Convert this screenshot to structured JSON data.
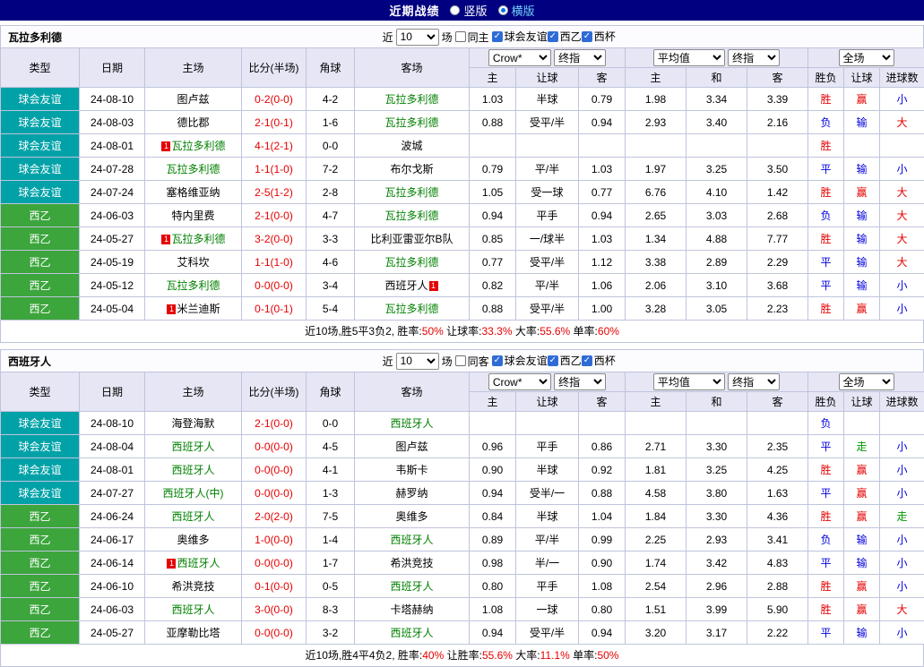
{
  "topbar": {
    "title": "近期战绩",
    "radios": [
      {
        "label": "竖版",
        "selected": false
      },
      {
        "label": "横版",
        "selected": true
      }
    ]
  },
  "controls_text": {
    "near": "近",
    "count": "10",
    "games": "场"
  },
  "header_cols": [
    "类型",
    "日期",
    "主场",
    "比分(半场)",
    "角球",
    "客场"
  ],
  "odds_subcols": [
    "主",
    "让球",
    "客",
    "主",
    "和",
    "客",
    "胜负",
    "让球",
    "进球数"
  ],
  "dropdowns": {
    "book": "Crow*",
    "final1": "终指",
    "avg": "平均值",
    "final2": "终指",
    "scope": "全场"
  },
  "colors": {
    "topbar_bg": "#000080",
    "header_bg": "#e6e6f5",
    "friendly_bg": "#00a2a8",
    "league2_bg": "#3ca53c",
    "focus_team": "#008000",
    "score_red": "#e60000",
    "result_red": "#e60000",
    "result_blue": "#0000dd",
    "result_green": "#009900"
  },
  "league_colors": {
    "球会友谊": "#00a2a8",
    "西乙": "#3ca53c",
    "西杯": "#3ca53c"
  },
  "result_colors": {
    "胜": "r",
    "平": "b",
    "负": "b",
    "赢": "r",
    "输": "b",
    "走": "g",
    "大": "r",
    "小": "b"
  },
  "sections": [
    {
      "team": "瓦拉多利德",
      "same_label": "同主",
      "filters": [
        {
          "label": "球会友谊",
          "checked": true
        },
        {
          "label": "西乙",
          "checked": true
        },
        {
          "label": "西杯",
          "checked": true
        }
      ],
      "rows": [
        {
          "league": "球会友谊",
          "date": "24-08-10",
          "home": {
            "n": "图卢兹"
          },
          "score": "0-2(0-0)",
          "corner": "4-2",
          "away": {
            "n": "瓦拉多利德",
            "f": 1
          },
          "odds": [
            "1.03",
            "半球",
            "0.79",
            "1.98",
            "3.34",
            "3.39"
          ],
          "res": [
            "胜",
            "赢",
            "小"
          ]
        },
        {
          "league": "球会友谊",
          "date": "24-08-03",
          "home": {
            "n": "德比郡"
          },
          "score": "2-1(0-1)",
          "corner": "1-6",
          "away": {
            "n": "瓦拉多利德",
            "f": 1
          },
          "odds": [
            "0.88",
            "受平/半",
            "0.94",
            "2.93",
            "3.40",
            "2.16"
          ],
          "res": [
            "负",
            "输",
            "大"
          ]
        },
        {
          "league": "球会友谊",
          "date": "24-08-01",
          "home": {
            "n": "瓦拉多利德",
            "f": 1,
            "bp": "1"
          },
          "score": "4-1(2-1)",
          "corner": "0-0",
          "away": {
            "n": "波城"
          },
          "odds": [
            "",
            "",
            "",
            "",
            "",
            ""
          ],
          "res": [
            "胜",
            "",
            ""
          ]
        },
        {
          "league": "球会友谊",
          "date": "24-07-28",
          "home": {
            "n": "瓦拉多利德",
            "f": 1
          },
          "score": "1-1(1-0)",
          "corner": "7-2",
          "away": {
            "n": "布尔戈斯"
          },
          "odds": [
            "0.79",
            "平/半",
            "1.03",
            "1.97",
            "3.25",
            "3.50"
          ],
          "res": [
            "平",
            "输",
            "小"
          ]
        },
        {
          "league": "球会友谊",
          "date": "24-07-24",
          "home": {
            "n": "塞格维亚纳"
          },
          "score": "2-5(1-2)",
          "corner": "2-8",
          "away": {
            "n": "瓦拉多利德",
            "f": 1
          },
          "odds": [
            "1.05",
            "受一球",
            "0.77",
            "6.76",
            "4.10",
            "1.42"
          ],
          "res": [
            "胜",
            "赢",
            "大"
          ]
        },
        {
          "league": "西乙",
          "date": "24-06-03",
          "home": {
            "n": "特内里费"
          },
          "score": "2-1(0-0)",
          "corner": "4-7",
          "away": {
            "n": "瓦拉多利德",
            "f": 1
          },
          "odds": [
            "0.94",
            "平手",
            "0.94",
            "2.65",
            "3.03",
            "2.68"
          ],
          "res": [
            "负",
            "输",
            "大"
          ]
        },
        {
          "league": "西乙",
          "date": "24-05-27",
          "home": {
            "n": "瓦拉多利德",
            "f": 1,
            "bp": "1"
          },
          "score": "3-2(0-0)",
          "corner": "3-3",
          "away": {
            "n": "比利亚雷亚尔B队"
          },
          "odds": [
            "0.85",
            "一/球半",
            "1.03",
            "1.34",
            "4.88",
            "7.77"
          ],
          "res": [
            "胜",
            "输",
            "大"
          ]
        },
        {
          "league": "西乙",
          "date": "24-05-19",
          "home": {
            "n": "艾科坎"
          },
          "score": "1-1(1-0)",
          "corner": "4-6",
          "away": {
            "n": "瓦拉多利德",
            "f": 1
          },
          "odds": [
            "0.77",
            "受平/半",
            "1.12",
            "3.38",
            "2.89",
            "2.29"
          ],
          "res": [
            "平",
            "输",
            "大"
          ]
        },
        {
          "league": "西乙",
          "date": "24-05-12",
          "home": {
            "n": "瓦拉多利德",
            "f": 1
          },
          "score": "0-0(0-0)",
          "corner": "3-4",
          "away": {
            "n": "西班牙人",
            "ba": "1"
          },
          "odds": [
            "0.82",
            "平/半",
            "1.06",
            "2.06",
            "3.10",
            "3.68"
          ],
          "res": [
            "平",
            "输",
            "小"
          ]
        },
        {
          "league": "西乙",
          "date": "24-05-04",
          "home": {
            "n": "米兰迪斯",
            "bp": "1"
          },
          "score": "0-1(0-1)",
          "corner": "5-4",
          "away": {
            "n": "瓦拉多利德",
            "f": 1
          },
          "odds": [
            "0.88",
            "受平/半",
            "1.00",
            "3.28",
            "3.05",
            "2.23"
          ],
          "res": [
            "胜",
            "赢",
            "小"
          ]
        }
      ],
      "summary": [
        {
          "t": "近10场,胜5平3负2, 胜率:"
        },
        {
          "t": "50%",
          "r": true
        },
        {
          "t": " 让球率:"
        },
        {
          "t": "33.3%",
          "r": true
        },
        {
          "t": " 大率:"
        },
        {
          "t": "55.6%",
          "r": true
        },
        {
          "t": " 单率:"
        },
        {
          "t": "60%",
          "r": true
        }
      ]
    },
    {
      "team": "西班牙人",
      "same_label": "同客",
      "filters": [
        {
          "label": "球会友谊",
          "checked": true
        },
        {
          "label": "西乙",
          "checked": true
        },
        {
          "label": "西杯",
          "checked": true
        }
      ],
      "rows": [
        {
          "league": "球会友谊",
          "date": "24-08-10",
          "home": {
            "n": "海登海默"
          },
          "score": "2-1(0-0)",
          "corner": "0-0",
          "away": {
            "n": "西班牙人",
            "f": 1
          },
          "odds": [
            "",
            "",
            "",
            "",
            "",
            ""
          ],
          "res": [
            "负",
            "",
            ""
          ]
        },
        {
          "league": "球会友谊",
          "date": "24-08-04",
          "home": {
            "n": "西班牙人",
            "f": 1
          },
          "score": "0-0(0-0)",
          "corner": "4-5",
          "away": {
            "n": "图卢兹"
          },
          "odds": [
            "0.96",
            "平手",
            "0.86",
            "2.71",
            "3.30",
            "2.35"
          ],
          "res": [
            "平",
            "走",
            "小"
          ]
        },
        {
          "league": "球会友谊",
          "date": "24-08-01",
          "home": {
            "n": "西班牙人",
            "f": 1
          },
          "score": "0-0(0-0)",
          "corner": "4-1",
          "away": {
            "n": "韦斯卡"
          },
          "odds": [
            "0.90",
            "半球",
            "0.92",
            "1.81",
            "3.25",
            "4.25"
          ],
          "res": [
            "胜",
            "赢",
            "小"
          ]
        },
        {
          "league": "球会友谊",
          "date": "24-07-27",
          "home": {
            "n": "西班牙人(中)",
            "f": 1
          },
          "score": "0-0(0-0)",
          "corner": "1-3",
          "away": {
            "n": "赫罗纳"
          },
          "odds": [
            "0.94",
            "受半/一",
            "0.88",
            "4.58",
            "3.80",
            "1.63"
          ],
          "res": [
            "平",
            "赢",
            "小"
          ]
        },
        {
          "league": "西乙",
          "date": "24-06-24",
          "home": {
            "n": "西班牙人",
            "f": 1
          },
          "score": "2-0(2-0)",
          "corner": "7-5",
          "away": {
            "n": "奥维多"
          },
          "odds": [
            "0.84",
            "半球",
            "1.04",
            "1.84",
            "3.30",
            "4.36"
          ],
          "res": [
            "胜",
            "赢",
            "走"
          ]
        },
        {
          "league": "西乙",
          "date": "24-06-17",
          "home": {
            "n": "奥维多"
          },
          "score": "1-0(0-0)",
          "corner": "1-4",
          "away": {
            "n": "西班牙人",
            "f": 1
          },
          "odds": [
            "0.89",
            "平/半",
            "0.99",
            "2.25",
            "2.93",
            "3.41"
          ],
          "res": [
            "负",
            "输",
            "小"
          ]
        },
        {
          "league": "西乙",
          "date": "24-06-14",
          "home": {
            "n": "西班牙人",
            "f": 1,
            "bp": "1"
          },
          "score": "0-0(0-0)",
          "corner": "1-7",
          "away": {
            "n": "希洪竞技"
          },
          "odds": [
            "0.98",
            "半/一",
            "0.90",
            "1.74",
            "3.42",
            "4.83"
          ],
          "res": [
            "平",
            "输",
            "小"
          ]
        },
        {
          "league": "西乙",
          "date": "24-06-10",
          "home": {
            "n": "希洪竞技"
          },
          "score": "0-1(0-0)",
          "corner": "0-5",
          "away": {
            "n": "西班牙人",
            "f": 1
          },
          "odds": [
            "0.80",
            "平手",
            "1.08",
            "2.54",
            "2.96",
            "2.88"
          ],
          "res": [
            "胜",
            "赢",
            "小"
          ]
        },
        {
          "league": "西乙",
          "date": "24-06-03",
          "home": {
            "n": "西班牙人",
            "f": 1
          },
          "score": "3-0(0-0)",
          "corner": "8-3",
          "away": {
            "n": "卡塔赫纳"
          },
          "odds": [
            "1.08",
            "一球",
            "0.80",
            "1.51",
            "3.99",
            "5.90"
          ],
          "res": [
            "胜",
            "赢",
            "大"
          ]
        },
        {
          "league": "西乙",
          "date": "24-05-27",
          "home": {
            "n": "亚摩勒比塔"
          },
          "score": "0-0(0-0)",
          "corner": "3-2",
          "away": {
            "n": "西班牙人",
            "f": 1
          },
          "odds": [
            "0.94",
            "受平/半",
            "0.94",
            "3.20",
            "3.17",
            "2.22"
          ],
          "res": [
            "平",
            "输",
            "小"
          ]
        }
      ],
      "summary": [
        {
          "t": "近10场,胜4平4负2, 胜率:"
        },
        {
          "t": "40%",
          "r": true
        },
        {
          "t": " 让胜率:"
        },
        {
          "t": "55.6%",
          "r": true
        },
        {
          "t": " 大率:"
        },
        {
          "t": "11.1%",
          "r": true
        },
        {
          "t": " 单率:"
        },
        {
          "t": "50%",
          "r": true
        }
      ]
    }
  ]
}
